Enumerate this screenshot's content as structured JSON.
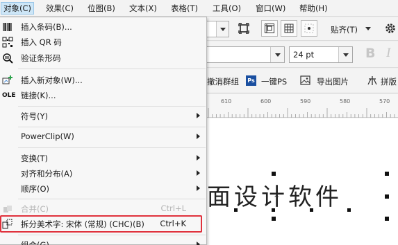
{
  "menubar": {
    "items": [
      {
        "label": "对象(C)",
        "active": true
      },
      {
        "label": "效果(C)"
      },
      {
        "label": "位图(B)"
      },
      {
        "label": "文本(X)"
      },
      {
        "label": "表格(T)"
      },
      {
        "label": "工具(O)"
      },
      {
        "label": "窗口(W)"
      },
      {
        "label": "帮助(H)"
      }
    ]
  },
  "object_menu": {
    "items": [
      {
        "label": "插入条码(B)...",
        "icon": "barcode-icon"
      },
      {
        "label": "插入 QR 码",
        "icon": "qr-code-icon"
      },
      {
        "label": "验证条形码",
        "icon": "verify-barcode-icon"
      },
      {
        "label": "插入新对象(W)...",
        "icon": "insert-object-icon"
      },
      {
        "label": "链接(K)...",
        "icon": "ole-link-icon",
        "icon_text": "OLE"
      },
      {
        "label": "符号(Y)",
        "submenu": true
      },
      {
        "label": "PowerClip(W)",
        "submenu": true
      },
      {
        "label": "变换(T)",
        "submenu": true
      },
      {
        "label": "对齐和分布(A)",
        "submenu": true
      },
      {
        "label": "顺序(O)",
        "submenu": true
      },
      {
        "label": "合并(C)",
        "shortcut": "Ctrl+L",
        "disabled": true,
        "icon": "combine-icon"
      },
      {
        "label": "拆分美术字: 宋体 (常规) (CHC)(B)",
        "shortcut": "Ctrl+K",
        "icon": "break-apart-icon",
        "highlighted": true
      },
      {
        "label": "组合(G)",
        "submenu": true
      }
    ]
  },
  "toolbar": {
    "snap_label": "贴齐(T)",
    "font_size": "24 pt",
    "bold_label": "B",
    "italic_label": "I",
    "break_group_label": "撤消群组",
    "one_key_ps_label": "一键PS",
    "export_image_label": "导出图片",
    "puzzle_label": "拼版"
  },
  "ruler": {
    "ticks": [
      "610",
      "600",
      "590",
      "580",
      "570"
    ]
  },
  "canvas": {
    "text": "面设计软件"
  },
  "colors": {
    "highlight_border": "#e0313c",
    "menu_active": "#cde6f7",
    "ps_icon": "#1a4fa0"
  }
}
